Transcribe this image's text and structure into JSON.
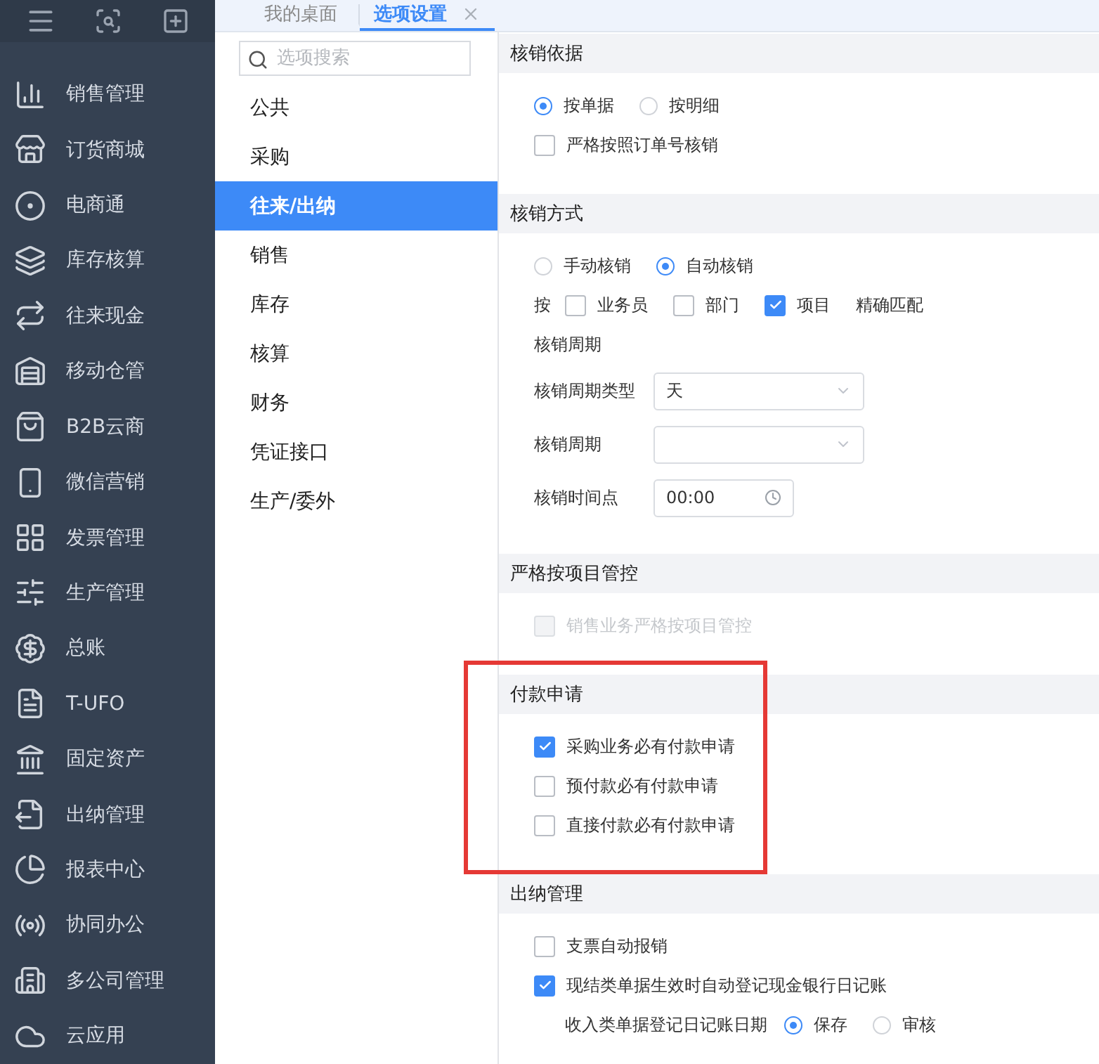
{
  "sidebar": {
    "items": [
      {
        "label": "销售管理"
      },
      {
        "label": "订货商城"
      },
      {
        "label": "电商通"
      },
      {
        "label": "库存核算"
      },
      {
        "label": "往来现金"
      },
      {
        "label": "移动仓管"
      },
      {
        "label": "B2B云商"
      },
      {
        "label": "微信营销"
      },
      {
        "label": "发票管理"
      },
      {
        "label": "生产管理"
      },
      {
        "label": "总账"
      },
      {
        "label": "T-UFO"
      },
      {
        "label": "固定资产"
      },
      {
        "label": "出纳管理"
      },
      {
        "label": "报表中心"
      },
      {
        "label": "协同办公"
      },
      {
        "label": "多公司管理"
      },
      {
        "label": "云应用"
      }
    ]
  },
  "tabs": [
    {
      "label": "我的桌面",
      "selected": false,
      "closable": false
    },
    {
      "label": "选项设置",
      "selected": true,
      "closable": true
    }
  ],
  "nav": {
    "search": {
      "placeholder": "选项搜索"
    },
    "items": [
      {
        "label": "公共",
        "selected": false
      },
      {
        "label": "采购",
        "selected": false
      },
      {
        "label": "往来/出纳",
        "selected": true
      },
      {
        "label": "销售",
        "selected": false
      },
      {
        "label": "库存",
        "selected": false
      },
      {
        "label": "核算",
        "selected": false
      },
      {
        "label": "财务",
        "selected": false
      },
      {
        "label": "凭证接口",
        "selected": false
      },
      {
        "label": "生产/委外",
        "selected": false
      }
    ]
  },
  "sections": [
    {
      "title": "核销依据",
      "highlighted": false,
      "rows": [
        {
          "kind": "radios",
          "options": [
            {
              "label": "按单据",
              "selected": true
            },
            {
              "label": "按明细",
              "selected": false
            }
          ]
        },
        {
          "kind": "checkbox",
          "label": "严格按照订单号核销",
          "checked": false,
          "disabled": false
        }
      ]
    },
    {
      "title": "核销方式",
      "highlighted": false,
      "rows": [
        {
          "kind": "radios",
          "options": [
            {
              "label": "手动核销",
              "selected": false
            },
            {
              "label": "自动核销",
              "selected": true
            }
          ]
        },
        {
          "kind": "checks",
          "prefix": "按",
          "options": [
            {
              "label": "业务员",
              "checked": false
            },
            {
              "label": "部门",
              "checked": false
            },
            {
              "label": "项目",
              "checked": true
            }
          ],
          "suffix": "精确匹配"
        },
        {
          "kind": "label",
          "label": "核销周期"
        },
        {
          "kind": "select",
          "label": "核销周期类型",
          "value": "天"
        },
        {
          "kind": "select",
          "label": "核销周期",
          "value": ""
        },
        {
          "kind": "time",
          "label": "核销时间点",
          "value": "00:00"
        }
      ]
    },
    {
      "title": "严格按项目管控",
      "highlighted": false,
      "rows": [
        {
          "kind": "checkbox",
          "label": "销售业务严格按项目管控",
          "checked": false,
          "disabled": true
        }
      ]
    },
    {
      "title": "付款申请",
      "highlighted": true,
      "rows": [
        {
          "kind": "checkbox",
          "label": "采购业务必有付款申请",
          "checked": true,
          "disabled": false
        },
        {
          "kind": "checkbox",
          "label": "预付款必有付款申请",
          "checked": false,
          "disabled": false
        },
        {
          "kind": "checkbox",
          "label": "直接付款必有付款申请",
          "checked": false,
          "disabled": false
        }
      ]
    },
    {
      "title": "出纳管理",
      "highlighted": false,
      "rows": [
        {
          "kind": "checkbox",
          "label": "支票自动报销",
          "checked": false,
          "disabled": false
        },
        {
          "kind": "checkbox",
          "label": "现结类单据生效时自动登记现金银行日记账",
          "checked": true,
          "disabled": false
        },
        {
          "kind": "labeled-radios",
          "label": "收入类单据登记日记账日期",
          "options": [
            {
              "label": "保存",
              "selected": true
            },
            {
              "label": "审核",
              "selected": false
            }
          ]
        }
      ]
    }
  ]
}
